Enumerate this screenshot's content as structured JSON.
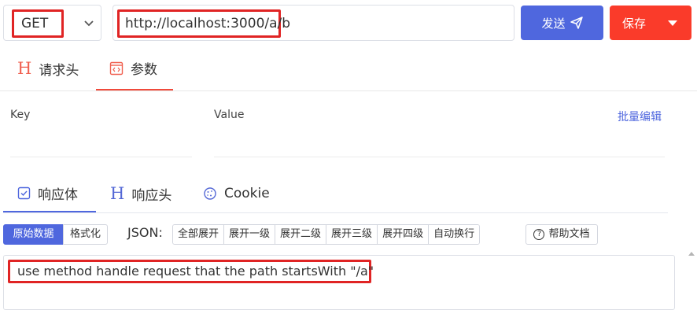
{
  "request": {
    "method": "GET",
    "url": "http://localhost:3000/a/b",
    "send_label": "发送",
    "save_label": "保存"
  },
  "request_tabs": [
    {
      "label": "请求头",
      "icon": "h-icon"
    },
    {
      "label": "参数",
      "icon": "code-doc-icon",
      "active": true
    }
  ],
  "params": {
    "key_header": "Key",
    "value_header": "Value",
    "bulk_edit_label": "批量编辑"
  },
  "response_tabs": [
    {
      "label": "响应体",
      "icon": "checkbox-icon",
      "active": true
    },
    {
      "label": "响应头",
      "icon": "h-icon"
    },
    {
      "label": "Cookie",
      "icon": "cookie-icon"
    }
  ],
  "toolbar": {
    "raw_label": "原始数据",
    "format_label": "格式化",
    "json_label": "JSON:",
    "expand_buttons": [
      "全部展开",
      "展开一级",
      "展开二级",
      "展开三级",
      "展开四级",
      "自动换行"
    ],
    "help_label": "帮助文档"
  },
  "response_body": "use method handle request that the path startsWith \"/a\"",
  "colors": {
    "primary": "#4f67de",
    "danger": "#fa3b2a",
    "highlight_box": "#e02424"
  }
}
